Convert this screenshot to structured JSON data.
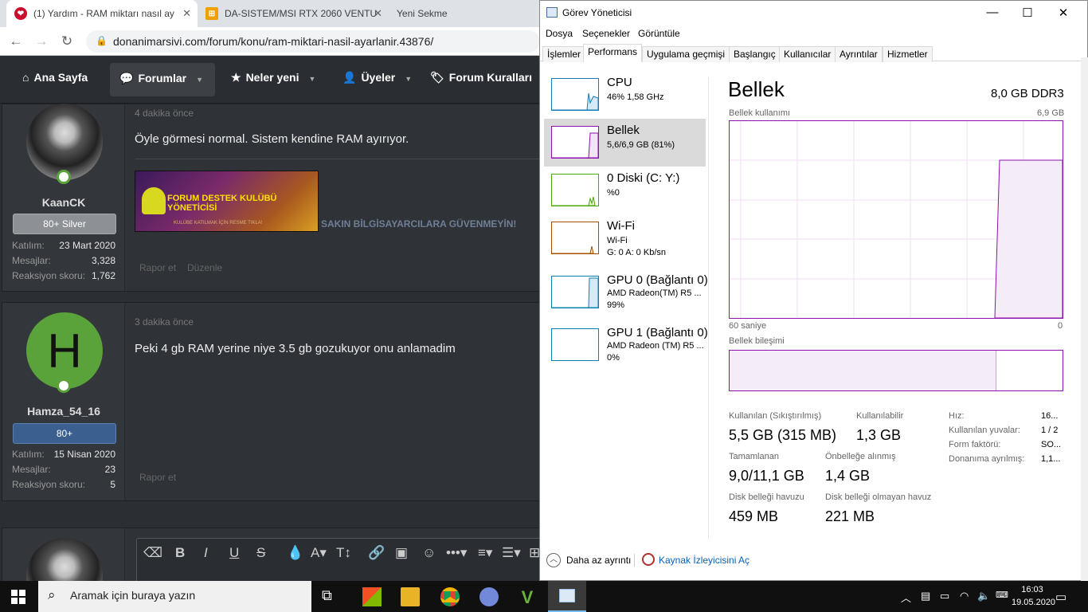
{
  "browser": {
    "tabs": [
      {
        "title": "(1) Yardım - RAM miktarı nasıl ay",
        "close": "✕"
      },
      {
        "title": "DA-SISTEM/MSI RTX 2060 VENTU",
        "close": "✕"
      },
      {
        "title": "Yeni Sekme"
      }
    ],
    "url": "donanimarsivi.com/forum/konu/ram-miktari-nasil-ayarlanir.43876/",
    "nav": [
      "Ana Sayfa",
      "Forumlar",
      "Neler yeni",
      "Üyeler",
      "Forum Kuralları"
    ]
  },
  "posts": [
    {
      "time": "4 dakika önce",
      "text": "Öyle görmesi normal. Sistem kendine RAM ayırıyor.",
      "user": "KaanCK",
      "title": "80+ Silver",
      "stats": [
        {
          "label": "Katılım:",
          "value": "23 Mart 2020"
        },
        {
          "label": "Mesajlar:",
          "value": "3,328"
        },
        {
          "label": "Reaksiyon skoru:",
          "value": "1,762"
        }
      ],
      "banner_text": "FORUM DESTEK KULÜBÜ YÖNETİCİSİ",
      "banner_sub": "KULÜBE KATILMAK İÇİN RESME TIKLA!",
      "signature": "SAKIN BİLGİSAYARCILARA GÜVENMEYİN!",
      "actions": [
        "Rapor et",
        "Düzenle"
      ]
    },
    {
      "time": "3 dakika önce",
      "text": "Peki 4 gb RAM yerine niye 3.5 gb gozukuyor onu anlamadim",
      "user": "Hamza_54_16",
      "avatar_letter": "H",
      "title": "80+",
      "stats": [
        {
          "label": "Katılım:",
          "value": "15 Nisan 2020"
        },
        {
          "label": "Mesajlar:",
          "value": "23"
        },
        {
          "label": "Reaksiyon skoru:",
          "value": "5"
        }
      ],
      "actions": [
        "Rapor et"
      ]
    }
  ],
  "taskmgr": {
    "title": "Görev Yöneticisi",
    "menu": [
      "Dosya",
      "Seçenekler",
      "Görüntüle"
    ],
    "tabs": [
      "İşlemler",
      "Performans",
      "Uygulama geçmişi",
      "Başlangıç",
      "Kullanıcılar",
      "Ayrıntılar",
      "Hizmetler"
    ],
    "resources": [
      {
        "name": "CPU",
        "line1": "46%  1,58 GHz",
        "line2": ""
      },
      {
        "name": "Bellek",
        "line1": "5,6/6,9 GB (81%)",
        "line2": ""
      },
      {
        "name": "0 Diski (C: Y:)",
        "line1": "%0",
        "line2": ""
      },
      {
        "name": "Wi-Fi",
        "line1": "Wi-Fi",
        "line2": "G: 0  A: 0 Kb/sn"
      },
      {
        "name": "GPU 0 (Bağlantı 0)",
        "line1": "AMD Radeon(TM) R5 ...",
        "line2": "99%"
      },
      {
        "name": "GPU 1 (Bağlantı 0)",
        "line1": "AMD Radeon (TM) R5 ...",
        "line2": "0%"
      }
    ],
    "detail": {
      "heading": "Bellek",
      "spec": "8,0 GB DDR3",
      "usage_label": "Bellek kullanımı",
      "usage_max": "6,9 GB",
      "axis_left": "60 saniye",
      "axis_right": "0",
      "composition_label": "Bellek bileşimi",
      "stats": [
        {
          "label": "Kullanılan (Sıkıştırılmış)",
          "value": "5,5 GB (315 MB)"
        },
        {
          "label": "Kullanılabilir",
          "value": "1,3 GB"
        },
        {
          "label": "Tamamlanan",
          "value": "9,0/11,1 GB"
        },
        {
          "label": "Önbelleğe alınmış",
          "value": "1,4 GB"
        },
        {
          "label": "Disk belleği havuzu",
          "value": "459 MB"
        },
        {
          "label": "Disk belleği olmayan havuz",
          "value": "221 MB"
        }
      ],
      "side": [
        {
          "label": "Hız:",
          "value": "16..."
        },
        {
          "label": "Kullanılan yuvalar:",
          "value": "1 / 2"
        },
        {
          "label": "Form faktörü:",
          "value": "SO..."
        },
        {
          "label": "Donanıma ayrılmış:",
          "value": "1,1..."
        }
      ]
    },
    "footer": {
      "less": "Daha az ayrıntı",
      "monitor": "Kaynak İzleyicisini Aç"
    }
  },
  "taskbar": {
    "search": "Aramak için buraya yazın",
    "time": "16:03",
    "date": "19.05.2020"
  }
}
